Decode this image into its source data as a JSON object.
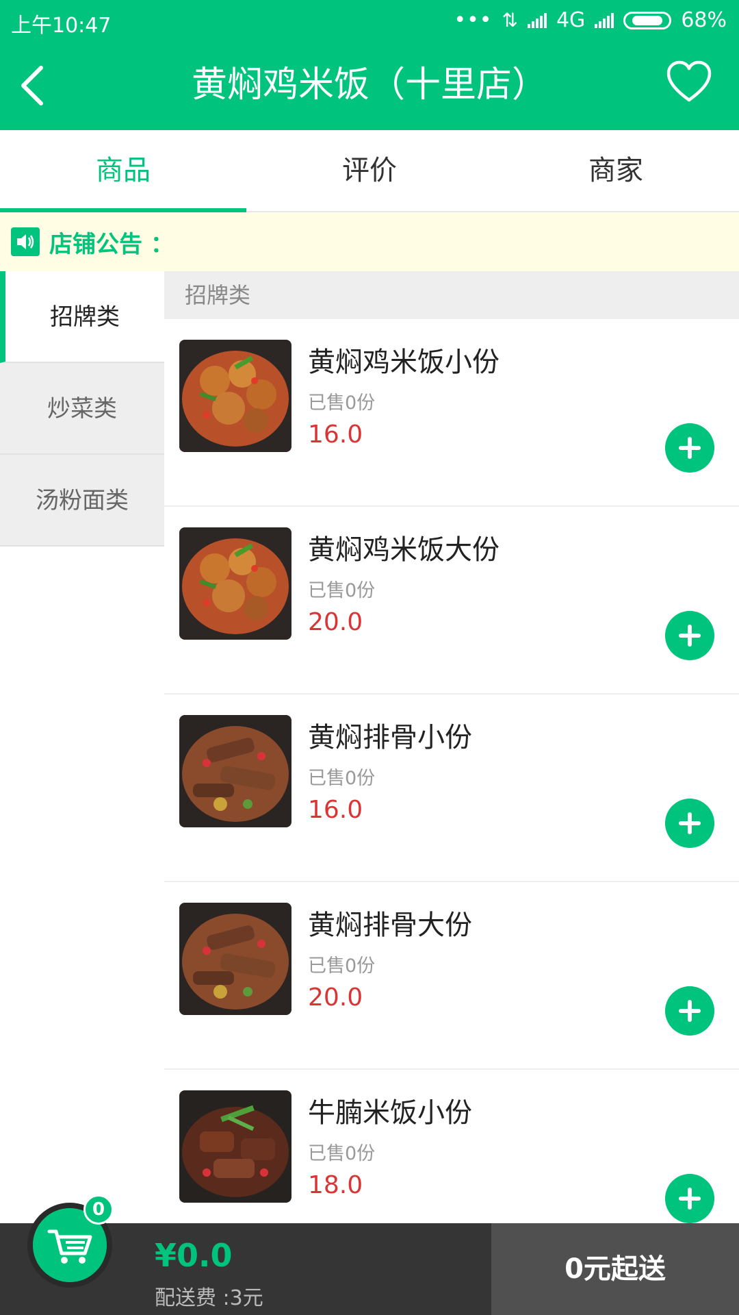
{
  "status_bar": {
    "time": "上午10:47",
    "network": "4G",
    "battery": "68%"
  },
  "header": {
    "title": "黄焖鸡米饭（十里店）"
  },
  "tabs": [
    {
      "label": "商品"
    },
    {
      "label": "评价"
    },
    {
      "label": "商家"
    }
  ],
  "notice": {
    "label": "店铺公告 ："
  },
  "categories": [
    {
      "label": "招牌类"
    },
    {
      "label": "炒菜类"
    },
    {
      "label": "汤粉面类"
    }
  ],
  "list": {
    "section_title": "招牌类",
    "products": [
      {
        "name": "黄焖鸡米饭小份",
        "sold": "已售0份",
        "price": "16.0"
      },
      {
        "name": "黄焖鸡米饭大份",
        "sold": "已售0份",
        "price": "20.0"
      },
      {
        "name": "黄焖排骨小份",
        "sold": "已售0份",
        "price": "16.0"
      },
      {
        "name": "黄焖排骨大份",
        "sold": "已售0份",
        "price": "20.0"
      },
      {
        "name": "牛腩米饭小份",
        "sold": "已售0份",
        "price": "18.0"
      }
    ]
  },
  "cart": {
    "count": "0",
    "total": "¥0.0",
    "delivery_fee": "配送费 :3元",
    "checkout_label": "0元起送"
  },
  "colors": {
    "brand": "#00c47d",
    "price": "#d93535",
    "bottom_bar": "#353535"
  },
  "icons": {
    "back": "back-arrow-icon",
    "favorite": "heart-icon",
    "notice": "speaker-icon",
    "add": "plus-icon",
    "cart": "cart-icon"
  }
}
